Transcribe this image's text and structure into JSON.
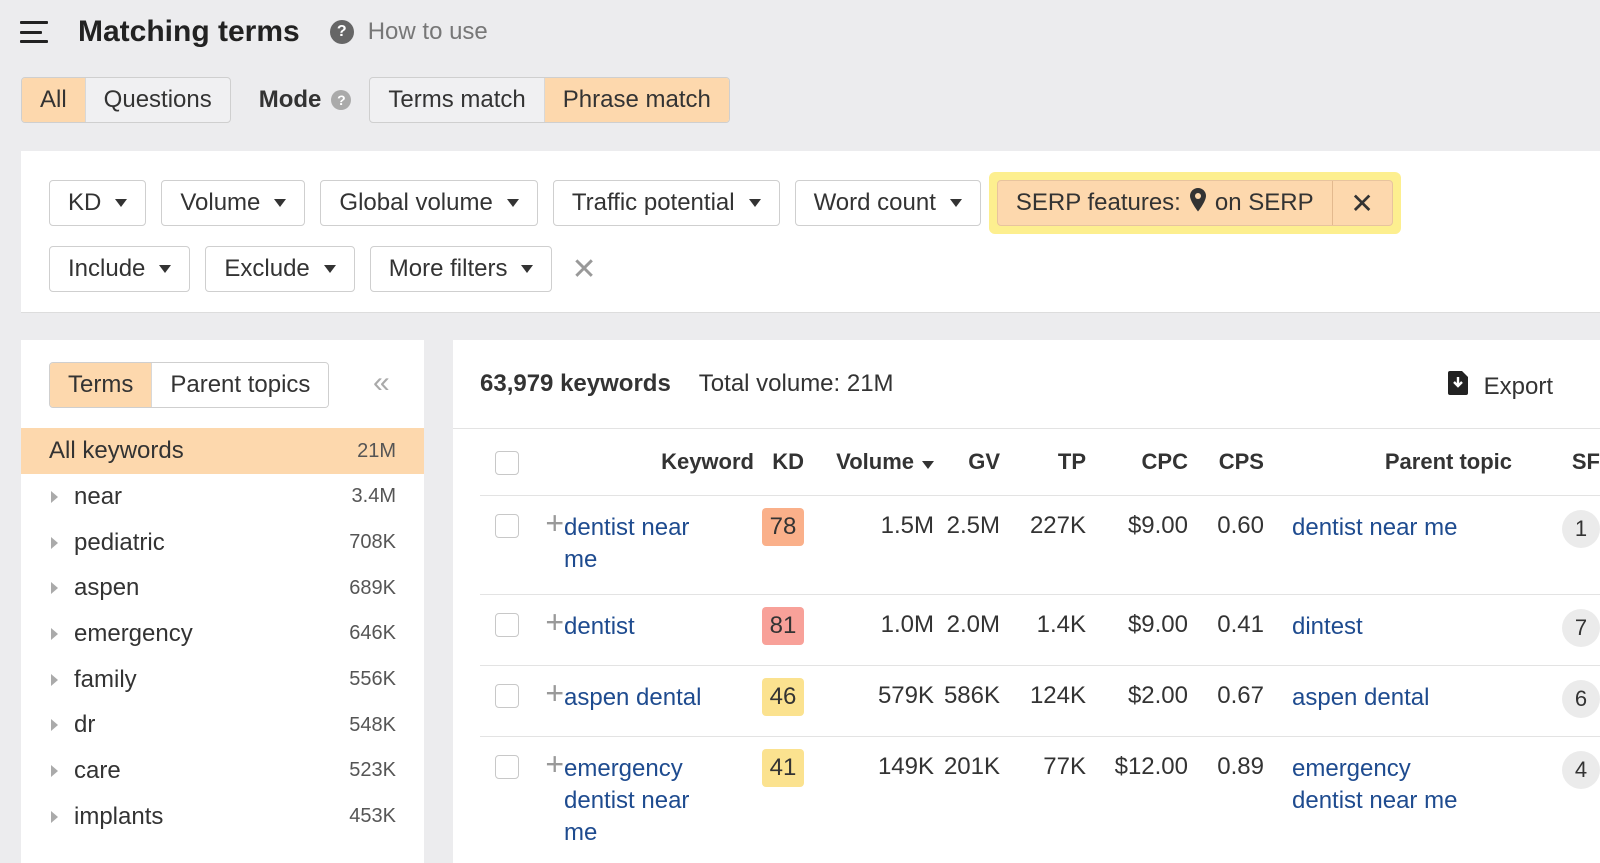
{
  "header": {
    "title": "Matching terms",
    "help_label": "How to use",
    "help_glyph": "?"
  },
  "scope_tabs": [
    {
      "label": "All",
      "active": true
    },
    {
      "label": "Questions",
      "active": false
    }
  ],
  "mode": {
    "label": "Mode",
    "help_glyph": "?",
    "options": [
      {
        "label": "Terms match",
        "active": false
      },
      {
        "label": "Phrase match",
        "active": true
      }
    ]
  },
  "filters": {
    "row1": [
      "KD",
      "Volume",
      "Global volume",
      "Traffic potential",
      "Word count"
    ],
    "serp": {
      "prefix": "SERP features:",
      "value": "on SERP",
      "icon": "map-pin-icon",
      "close_glyph": "✕"
    },
    "row2": [
      "Include",
      "Exclude",
      "More filters"
    ],
    "clear_glyph": "✕"
  },
  "sidebar": {
    "tabs": [
      {
        "label": "Terms",
        "active": true
      },
      {
        "label": "Parent topics",
        "active": false
      }
    ],
    "collapse_glyph": "«",
    "all": {
      "label": "All keywords",
      "count": "21M"
    },
    "terms": [
      {
        "label": "near",
        "count": "3.4M"
      },
      {
        "label": "pediatric",
        "count": "708K"
      },
      {
        "label": "aspen",
        "count": "689K"
      },
      {
        "label": "emergency",
        "count": "646K"
      },
      {
        "label": "family",
        "count": "556K"
      },
      {
        "label": "dr",
        "count": "548K"
      },
      {
        "label": "care",
        "count": "523K"
      },
      {
        "label": "implants",
        "count": "453K"
      }
    ]
  },
  "results": {
    "count_label": "63,979 keywords",
    "total_label": "Total volume: 21M",
    "export_label": "Export",
    "columns": {
      "keyword": "Keyword",
      "kd": "KD",
      "volume": "Volume",
      "gv": "GV",
      "tp": "TP",
      "cpc": "CPC",
      "cps": "CPS",
      "parent": "Parent topic",
      "sf": "SF"
    },
    "kd_colors": {
      "hard": "#fab08a",
      "very_hard": "#f8a199",
      "medium": "#fbe28f"
    },
    "rows": [
      {
        "keyword": "dentist near me",
        "kd": "78",
        "kd_level": "hard",
        "volume": "1.5M",
        "gv": "2.5M",
        "tp": "227K",
        "cpc": "$9.00",
        "cps": "0.60",
        "parent": "dentist near me",
        "sf": "1"
      },
      {
        "keyword": "dentist",
        "kd": "81",
        "kd_level": "very_hard",
        "volume": "1.0M",
        "gv": "2.0M",
        "tp": "1.4K",
        "cpc": "$9.00",
        "cps": "0.41",
        "parent": "dintest",
        "sf": "7"
      },
      {
        "keyword": "aspen dental",
        "kd": "46",
        "kd_level": "medium",
        "volume": "579K",
        "gv": "586K",
        "tp": "124K",
        "cpc": "$2.00",
        "cps": "0.67",
        "parent": "aspen dental",
        "sf": "6"
      },
      {
        "keyword": "emergency dentist near me",
        "kd": "41",
        "kd_level": "medium",
        "volume": "149K",
        "gv": "201K",
        "tp": "77K",
        "cpc": "$12.00",
        "cps": "0.89",
        "parent": "emergency dentist near me",
        "sf": "4"
      }
    ]
  }
}
